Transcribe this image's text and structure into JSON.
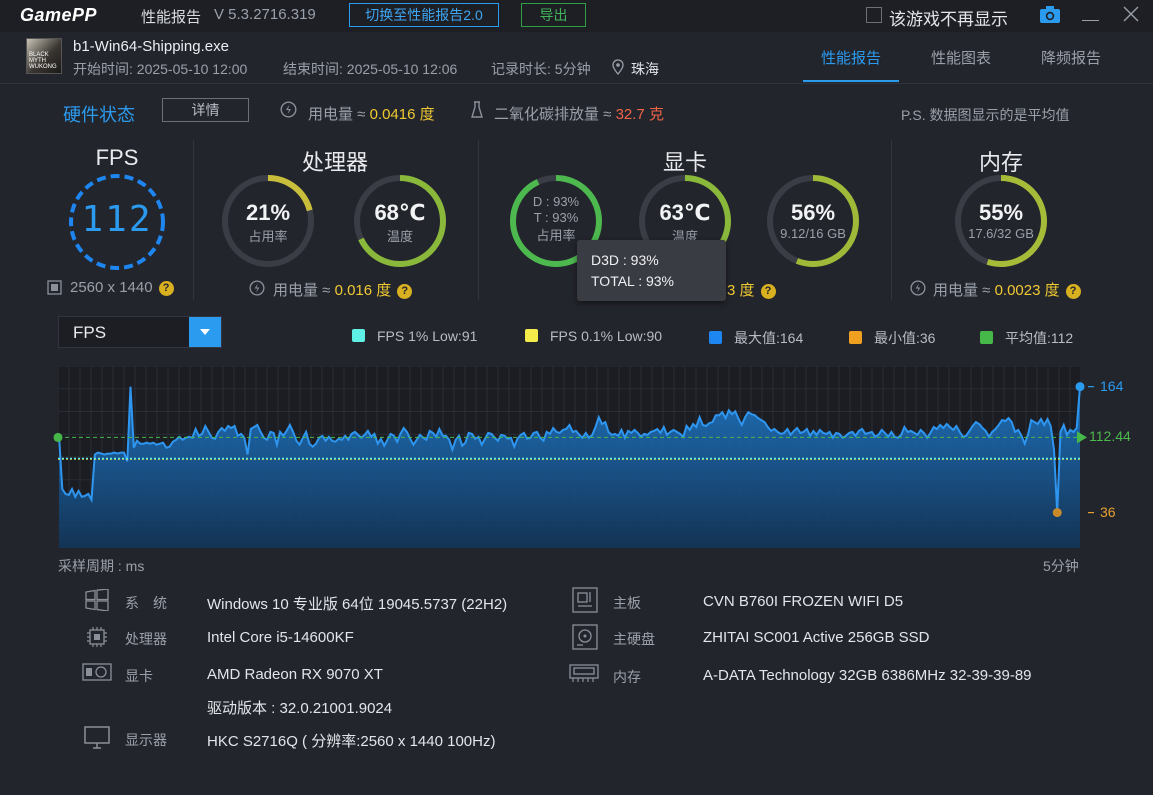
{
  "titlebar": {
    "logo": "GamePP",
    "title": "性能报告",
    "version": "V 5.3.2716.319",
    "switch_button": "切换至性能报告2.0",
    "export_button": "导出",
    "dont_show_label": "该游戏不再显示"
  },
  "header": {
    "thumb_text": "BLACK MYTH WUKONG",
    "exe": "b1-Win64-Shipping.exe",
    "start": "开始时间: 2025-05-10 12:00",
    "end": "结束时间: 2025-05-10 12:06",
    "duration": "记录时长: 5分钟",
    "location": "珠海",
    "tabs": [
      "性能报告",
      "性能图表",
      "降频报告"
    ]
  },
  "status": {
    "title": "硬件状态",
    "detail_button": "详情",
    "power_label": "用电量 ≈",
    "power_value": "0.0416 度",
    "co2_label": "二氧化碳排放量 ≈",
    "co2_value": "32.7 克",
    "note": "P.S. 数据图显示的是平均值"
  },
  "fps_card": {
    "title": "FPS",
    "value": "112",
    "resolution": "2560 x 1440"
  },
  "cpu_card": {
    "title": "处理器",
    "usage_value": "21%",
    "usage_label": "占用率",
    "usage_fraction": 0.21,
    "temp_value": "68℃",
    "temp_label": "温度",
    "temp_fraction": 0.68,
    "power_label": "用电量 ≈",
    "power_value": "0.016 度"
  },
  "gpu_card": {
    "title": "显卡",
    "d_line": "D : 93%",
    "t_line": "T : 93%",
    "usage_label": "占用率",
    "usage_fraction": 0.93,
    "temp_value": "63℃",
    "temp_label": "温度",
    "temp_fraction": 0.63,
    "vram_value": "56%",
    "vram_label": "9.12/16 GB",
    "vram_fraction": 0.56,
    "power_tail": "3 度"
  },
  "mem_card": {
    "title": "内存",
    "usage_value": "55%",
    "usage_label": "17.6/32 GB",
    "usage_fraction": 0.55,
    "power_label": "用电量 ≈",
    "power_value": "0.0023 度"
  },
  "tooltip": {
    "d3d": "D3D : 93%",
    "total": "TOTAL : 93%"
  },
  "chart_controls": {
    "selector": "FPS",
    "legend": [
      {
        "label": "FPS 1% Low:91",
        "color": "#5ef0e4"
      },
      {
        "label": "FPS 0.1% Low:90",
        "color": "#f3ec4a"
      },
      {
        "label": "最大值:164",
        "color": "#1e86f0"
      },
      {
        "label": "最小值:36",
        "color": "#f0a020"
      },
      {
        "label": "平均值:112",
        "color": "#46b84a"
      }
    ]
  },
  "chart_data": {
    "type": "area",
    "title": "",
    "xlabel": "采样周期 : ms",
    "x_end_label": "5分钟",
    "ylim": [
      0,
      185
    ],
    "max_label": "164",
    "avg_label": "112.44",
    "min_label": "36",
    "low1_line": 91,
    "low01_line": 90,
    "avg_line": 112.44,
    "values": [
      115,
      60,
      55,
      54,
      60,
      52,
      58,
      52,
      53,
      55,
      49,
      95,
      97,
      96,
      95,
      96,
      96,
      97,
      96,
      97,
      97,
      88,
      164,
      102,
      109,
      106,
      106,
      107,
      106,
      107,
      105,
      106,
      107,
      102,
      103,
      108,
      110,
      113,
      110,
      112,
      113,
      112,
      121,
      114,
      116,
      124,
      118,
      112,
      111,
      118,
      122,
      119,
      124,
      122,
      124,
      114,
      116,
      112,
      95,
      121,
      123,
      125,
      118,
      112,
      110,
      118,
      117,
      105,
      118,
      114,
      119,
      125,
      118,
      109,
      105,
      112,
      118,
      106,
      103,
      106,
      112,
      114,
      109,
      113,
      109,
      108,
      111,
      110,
      114,
      110,
      116,
      118,
      115,
      112,
      115,
      119,
      113,
      116,
      106,
      111,
      104,
      110,
      116,
      114,
      108,
      116,
      122,
      118,
      111,
      105,
      110,
      115,
      112,
      110,
      119,
      117,
      113,
      121,
      114,
      114,
      110,
      100,
      110,
      114,
      104,
      107,
      117,
      116,
      111,
      113,
      105,
      111,
      117,
      116,
      112,
      109,
      115,
      114,
      111,
      112,
      103,
      111,
      115,
      117,
      111,
      112,
      117,
      118,
      112,
      109,
      118,
      116,
      122,
      118,
      117,
      120,
      121,
      125,
      118,
      119,
      115,
      112,
      117,
      112,
      115,
      123,
      133,
      126,
      128,
      118,
      115,
      116,
      114,
      120,
      112,
      119,
      117,
      120,
      117,
      113,
      116,
      115,
      118,
      119,
      121,
      117,
      123,
      115,
      118,
      120,
      118,
      116,
      113,
      124,
      120,
      126,
      123,
      133,
      125,
      124,
      127,
      128,
      135,
      135,
      138,
      132,
      140,
      136,
      139,
      131,
      125,
      133,
      138,
      136,
      135,
      132,
      130,
      128,
      123,
      119,
      121,
      118,
      116,
      117,
      121,
      115,
      119,
      122,
      117,
      118,
      121,
      114,
      119,
      115,
      120,
      117,
      116,
      118,
      112,
      117,
      116,
      112,
      114,
      117,
      118,
      114,
      119,
      121,
      116,
      117,
      118,
      113,
      115,
      120,
      117,
      113,
      118,
      113,
      112,
      115,
      123,
      118,
      119,
      117,
      115,
      120,
      117,
      112,
      117,
      123,
      121,
      125,
      122,
      126,
      123,
      120,
      124,
      118,
      113,
      114,
      119,
      124,
      128,
      126,
      122,
      119,
      113,
      118,
      121,
      125,
      130,
      129,
      132,
      128,
      118,
      120,
      114,
      106,
      115,
      130,
      128,
      126,
      131,
      125,
      131,
      124,
      100,
      36,
      118,
      125,
      115,
      120,
      118,
      122,
      164
    ]
  },
  "info": {
    "left": [
      {
        "icon": "windows-icon",
        "key": "系　统",
        "value": "Windows 10 专业版 64位 19045.5737 (22H2)"
      },
      {
        "icon": "cpu-icon",
        "key": "处理器",
        "value": "Intel Core i5-14600KF"
      },
      {
        "icon": "gpu-icon",
        "key": "显卡",
        "value": "AMD Radeon RX 9070 XT"
      },
      {
        "icon": "",
        "key": "",
        "value": "驱动版本 : 32.0.21001.9024"
      },
      {
        "icon": "monitor-icon",
        "key": "显示器",
        "value": "HKC S2716Q ( 分辨率:2560 x 1440 100Hz)"
      }
    ],
    "right": [
      {
        "icon": "motherboard-icon",
        "key": "主板",
        "value": "CVN B760I FROZEN WIFI D5"
      },
      {
        "icon": "disk-icon",
        "key": "主硬盘",
        "value": "ZHITAI SC001 Active 256GB SSD"
      },
      {
        "icon": "memory-icon",
        "key": "内存",
        "value": "A-DATA Technology 32GB 6386MHz 32-39-39-89"
      }
    ]
  }
}
